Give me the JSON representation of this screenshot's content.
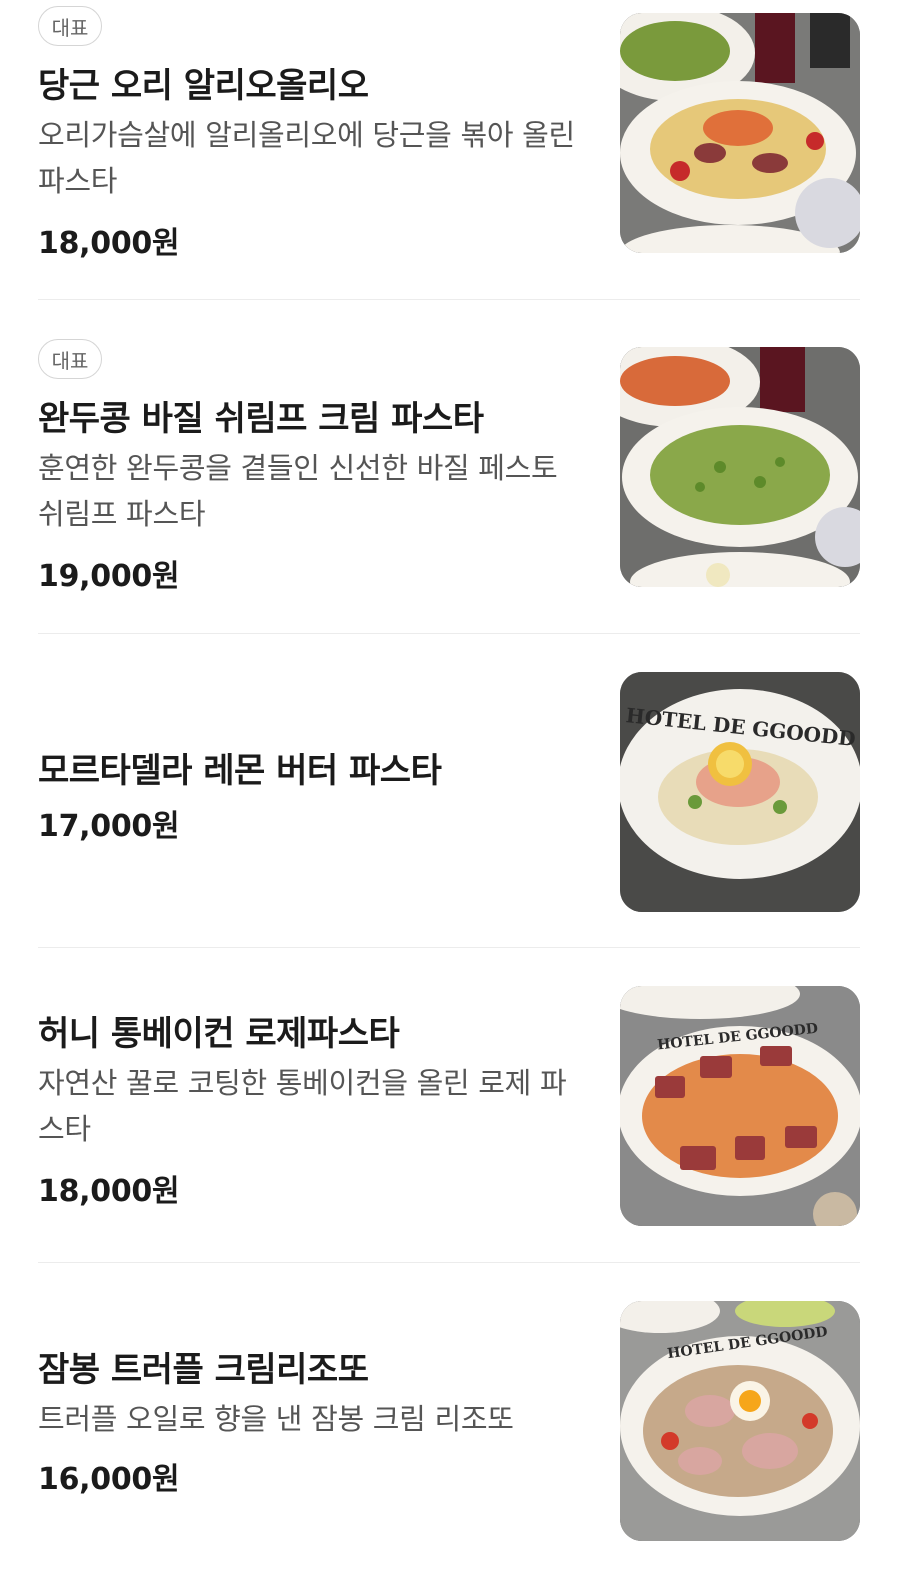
{
  "menu": {
    "items": [
      {
        "badge": "대표",
        "name": "당근 오리 알리오올리오",
        "description": "오리가슴살에 알리올리오에 당근을 볶아 올린 파스타",
        "price": "18,000원",
        "photo": "pasta-photo-carrot-duck"
      },
      {
        "badge": "대표",
        "name": "완두콩 바질 쉬림프 크림 파스타",
        "description": "훈연한 완두콩을 곁들인 신선한 바질 페스토 쉬림프 파스타",
        "price": "19,000원",
        "photo": "pasta-photo-pea-basil"
      },
      {
        "name": "모르타델라 레몬 버터 파스타",
        "price": "17,000원",
        "photo": "pasta-photo-lemon-butter",
        "plate_text": "HOTEL DE GGOODD"
      },
      {
        "name": "허니 통베이컨 로제파스타",
        "description": "자연산 꿀로 코팅한 통베이컨을 올린 로제 파스타",
        "price": "18,000원",
        "photo": "pasta-photo-rose-bacon",
        "plate_text": "HOTEL DE GGOODD"
      },
      {
        "name": "잠봉 트러플 크림리조또",
        "description": "트러플 오일로 향을 낸 잠봉 크림 리조또",
        "price": "16,000원",
        "photo": "risotto-photo-truffle",
        "plate_text": "HOTEL DE GGOODD"
      }
    ]
  }
}
